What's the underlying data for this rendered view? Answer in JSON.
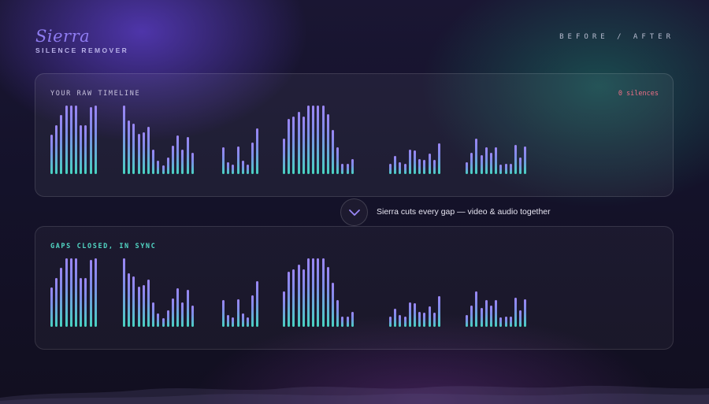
{
  "brand": {
    "name": "Sierra",
    "subtitle": "SILENCE REMOVER"
  },
  "header": {
    "before_after": "BEFORE / AFTER"
  },
  "raw_panel": {
    "title": "YOUR RAW TIMELINE",
    "silences": "0 silences"
  },
  "transition": {
    "icon": "chevron-down-icon",
    "caption": "Sierra cuts every gap — video & audio together"
  },
  "synced_panel": {
    "title": "GAPS CLOSED, IN SYNC"
  },
  "colors": {
    "accent_purple": "#8f7cf2",
    "accent_teal": "#47d3c1",
    "silence_red": "#ef6f86"
  },
  "waveform": {
    "clips": [
      [
        0.57,
        0.71,
        0.86,
        1.0,
        1.0,
        1.0,
        0.71,
        0.71,
        0.98,
        1.0
      ],
      [
        1.0,
        0.78,
        0.74,
        0.59,
        0.61,
        0.69,
        0.36,
        0.19,
        0.13,
        0.24,
        0.41,
        0.56,
        0.36,
        0.54,
        0.31
      ],
      [
        0.39,
        0.17,
        0.14,
        0.4,
        0.2,
        0.14,
        0.46,
        0.67
      ],
      [
        0.52,
        0.81,
        0.84,
        0.91,
        0.84,
        1.0,
        1.0,
        1.0,
        1.0,
        0.87,
        0.64,
        0.39,
        0.15,
        0.15,
        0.22
      ],
      [
        0.15,
        0.27,
        0.17,
        0.15,
        0.36,
        0.34,
        0.22,
        0.21,
        0.3,
        0.21,
        0.45
      ],
      [
        0.17,
        0.31,
        0.52,
        0.28,
        0.39,
        0.31,
        0.39,
        0.14,
        0.15,
        0.15,
        0.43,
        0.24,
        0.4
      ]
    ]
  }
}
